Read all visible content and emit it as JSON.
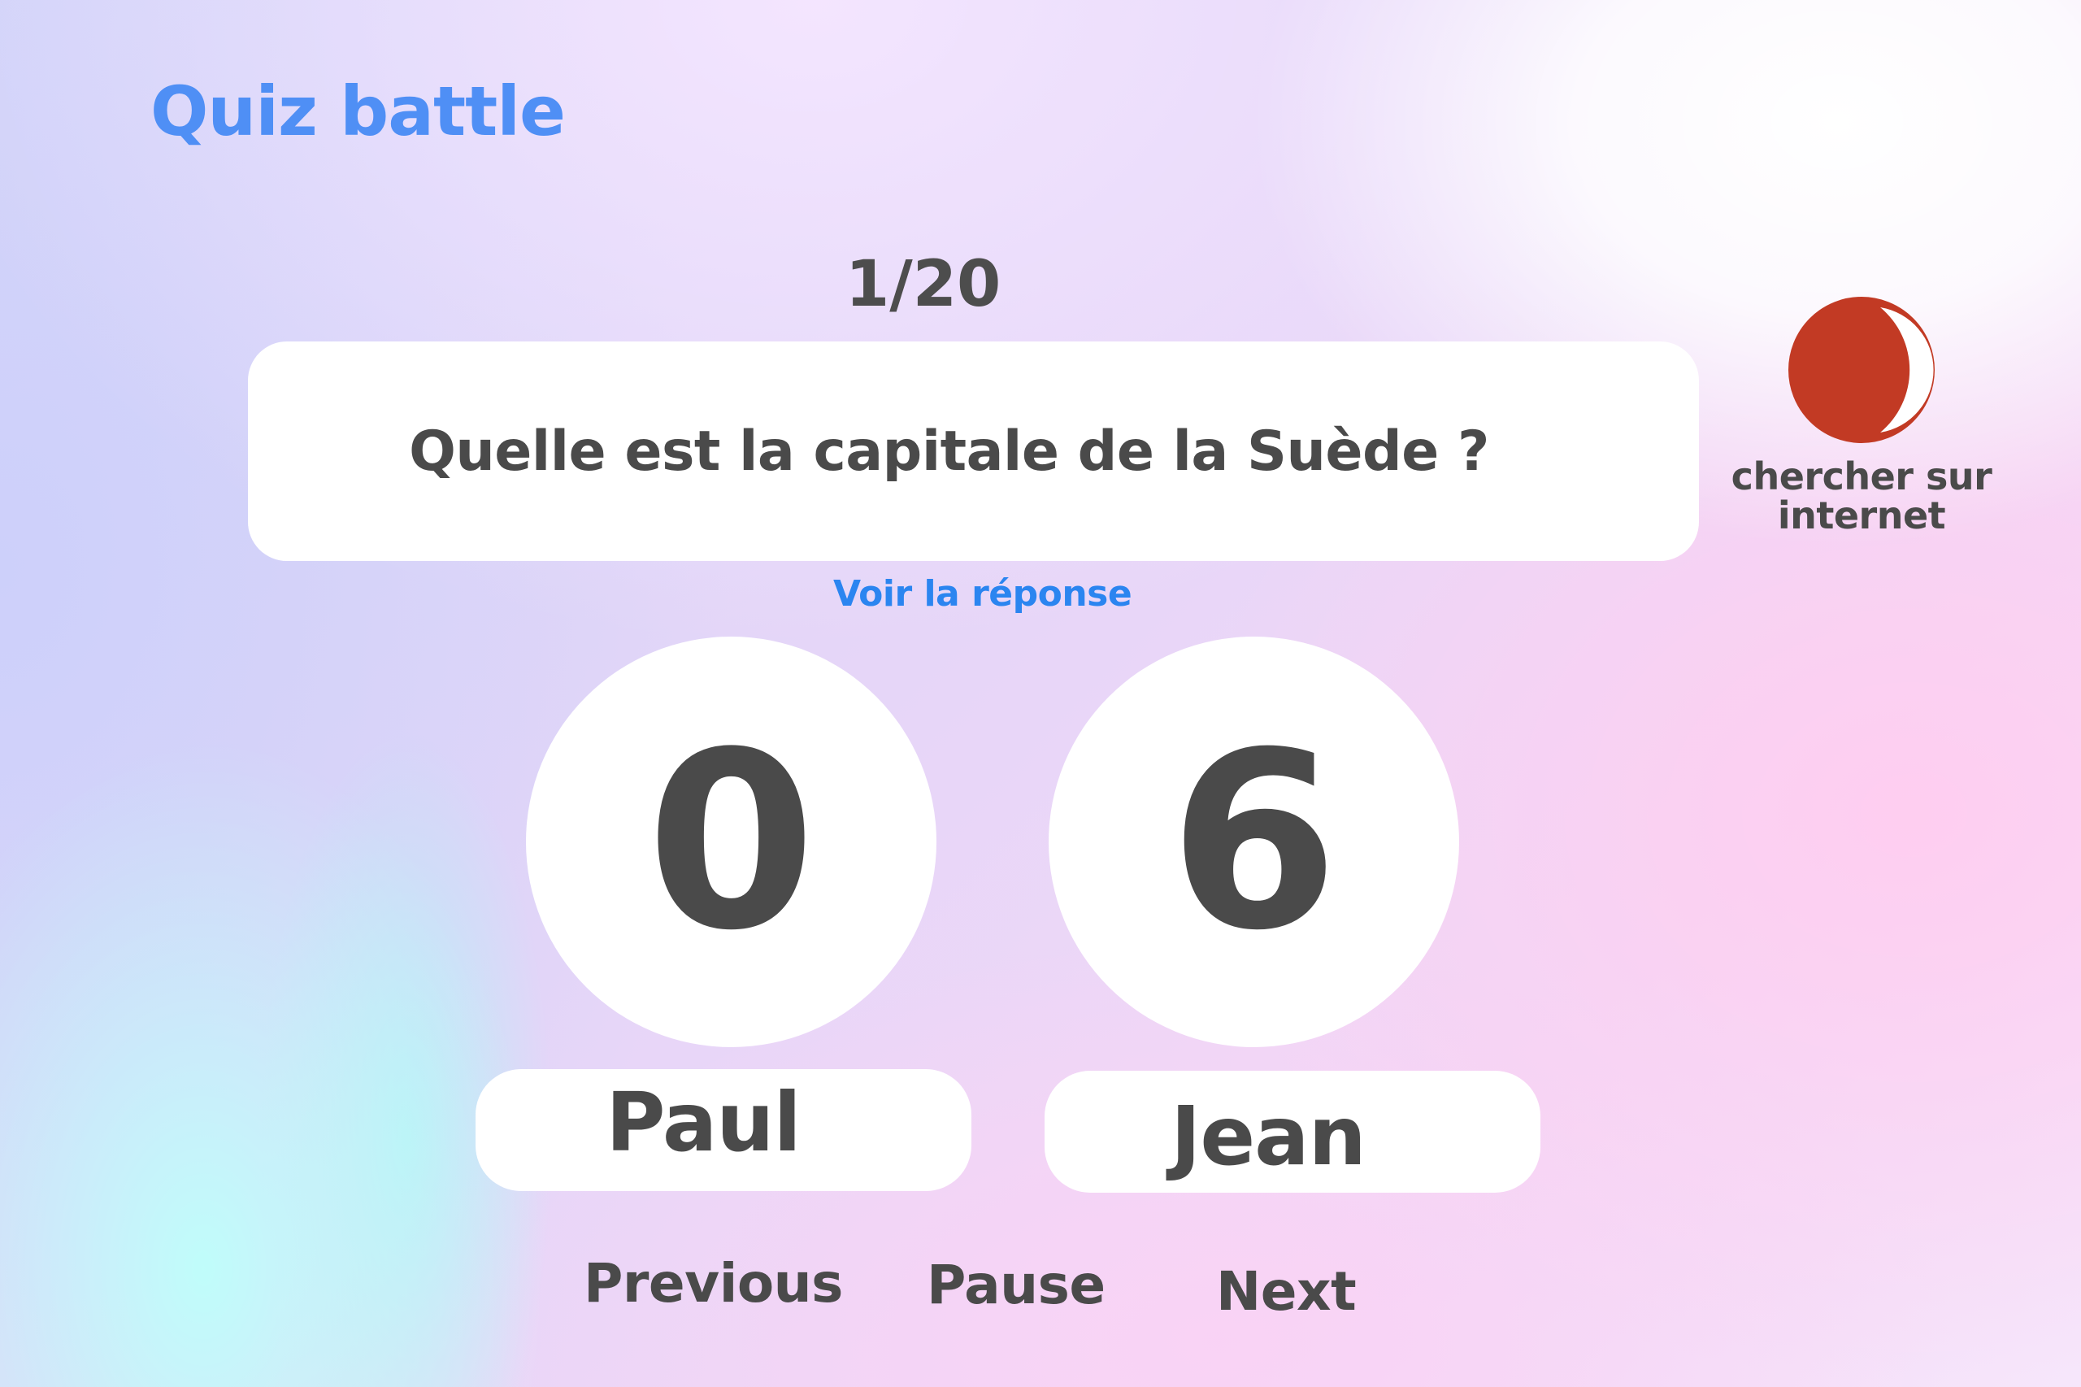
{
  "app": {
    "title": "Quiz battle"
  },
  "quiz": {
    "counter": "1/20",
    "question": "Quelle est la capitale de la Suède ?",
    "reveal_label": "Voir la réponse"
  },
  "search": {
    "label": "chercher sur internet",
    "icon": "moon-icon"
  },
  "players": [
    {
      "name": "Paul",
      "score": "0"
    },
    {
      "name": "Jean",
      "score": "6"
    }
  ],
  "controls": {
    "previous_label": "Previous",
    "pause_label": "Pause",
    "next_label": "Next"
  },
  "colors": {
    "accent": "#4f8ff5",
    "link": "#2b85f0",
    "text": "#4a4a4a",
    "moon": "#c23a24"
  }
}
